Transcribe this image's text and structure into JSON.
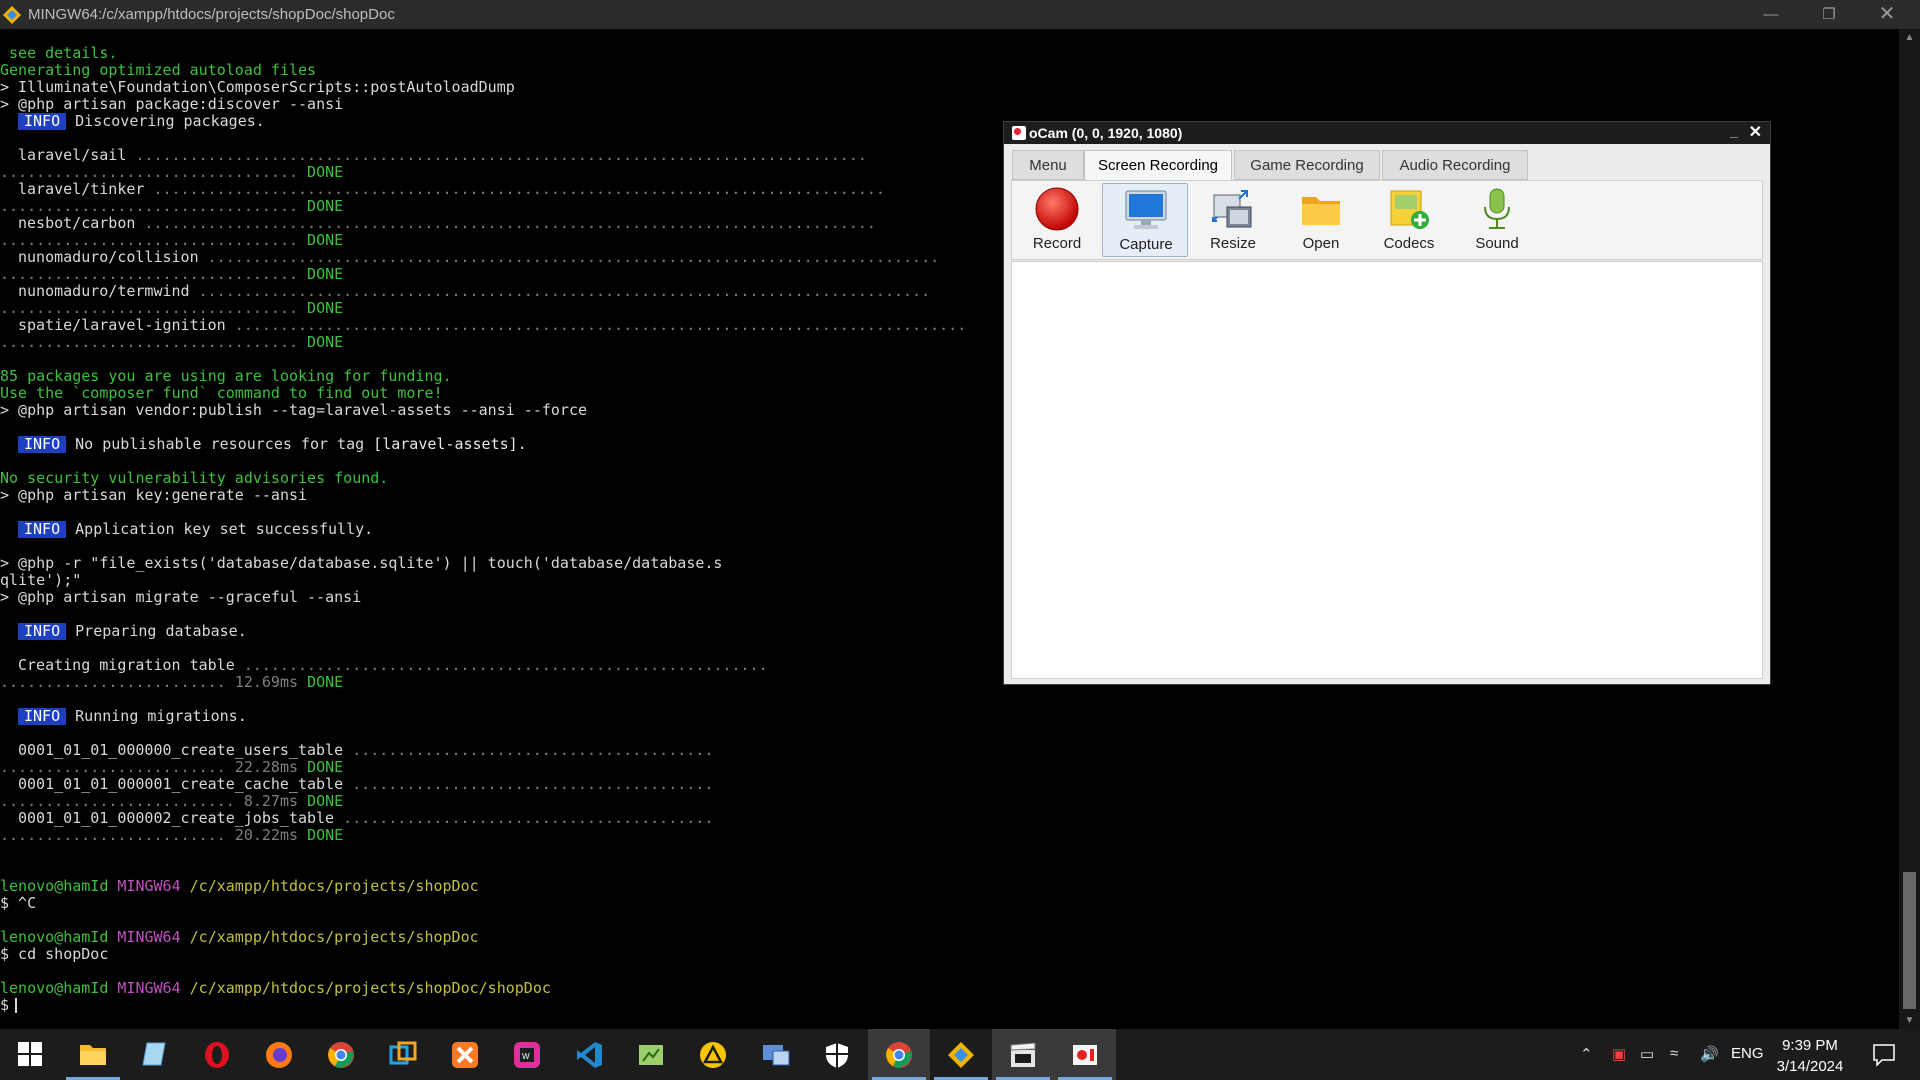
{
  "window": {
    "title": "MINGW64:/c/xampp/htdocs/projects/shopDoc/shopDoc"
  },
  "terminal": {
    "lines": [
      " see details.",
      "Generating optimized autoload files",
      "> Illuminate\\Foundation\\ComposerScripts::postAutoloadDump",
      "> @php artisan package:discover --ansi",
      "",
      "INFO",
      "Discovering packages.",
      "laravel/sail",
      "laravel/tinker",
      "nesbot/carbon",
      "nunomaduro/collision",
      "nunomaduro/termwind",
      "spatie/laravel-ignition",
      "DONE",
      "85 packages you are using are looking for funding.",
      "Use the `composer fund` command to find out more!",
      "> @php artisan vendor:publish --tag=laravel-assets --ansi --force",
      "No publishable resources for tag ",
      "[laravel-assets]",
      ".",
      "No security vulnerability advisories found.",
      "> @php artisan key:generate --ansi",
      "Application key set successfully.",
      "> @php -r \"file_exists('database/database.sqlite') || touch('database/database.s",
      "qlite');\"",
      "> @php artisan migrate --graceful --ansi",
      "Preparing database.",
      "Creating migration table",
      "12.69ms",
      "Running migrations.",
      "0001_01_01_000000_create_users_table",
      "22.28ms",
      "0001_01_01_000001_create_cache_table",
      "8.27ms",
      "0001_01_01_000002_create_jobs_table",
      "20.22ms",
      "lenovo@hamId",
      "MINGW64",
      "/c/xampp/htdocs/projects/shopDoc",
      "$ ^C",
      "$ cd shopDoc",
      "/c/xampp/htdocs/projects/shopDoc/shopDoc",
      "$"
    ],
    "dots_long": " .................................................................................",
    "dots_short": "................................. "
  },
  "ocam": {
    "title": "oCam (0, 0, 1920, 1080)",
    "tabs": [
      "Menu",
      "Screen Recording",
      "Game Recording",
      "Audio Recording"
    ],
    "active_tab": "Screen Recording",
    "tools": [
      "Record",
      "Capture",
      "Resize",
      "Open",
      "Codecs",
      "Sound"
    ]
  },
  "taskbar": {
    "apps": [
      "start-icon",
      "file-explorer-icon",
      "notepad-icon",
      "opera-icon",
      "firefox-icon",
      "chrome-icon",
      "app-icon",
      "xampp-icon",
      "webstorm-icon",
      "vscode-icon",
      "editor-icon",
      "warning-app-icon",
      "display-icon",
      "security-icon",
      "chrome-icon",
      "git-icon",
      "video-editor-icon",
      "ocam-icon"
    ],
    "language": "ENG",
    "time": "9:39 PM",
    "date": "3/14/2024"
  },
  "colors": {
    "info_badge": "#1e3fbf",
    "green": "#3cc13c",
    "magenta": "#c050c0",
    "ocam_title": "#1d1d1d"
  }
}
